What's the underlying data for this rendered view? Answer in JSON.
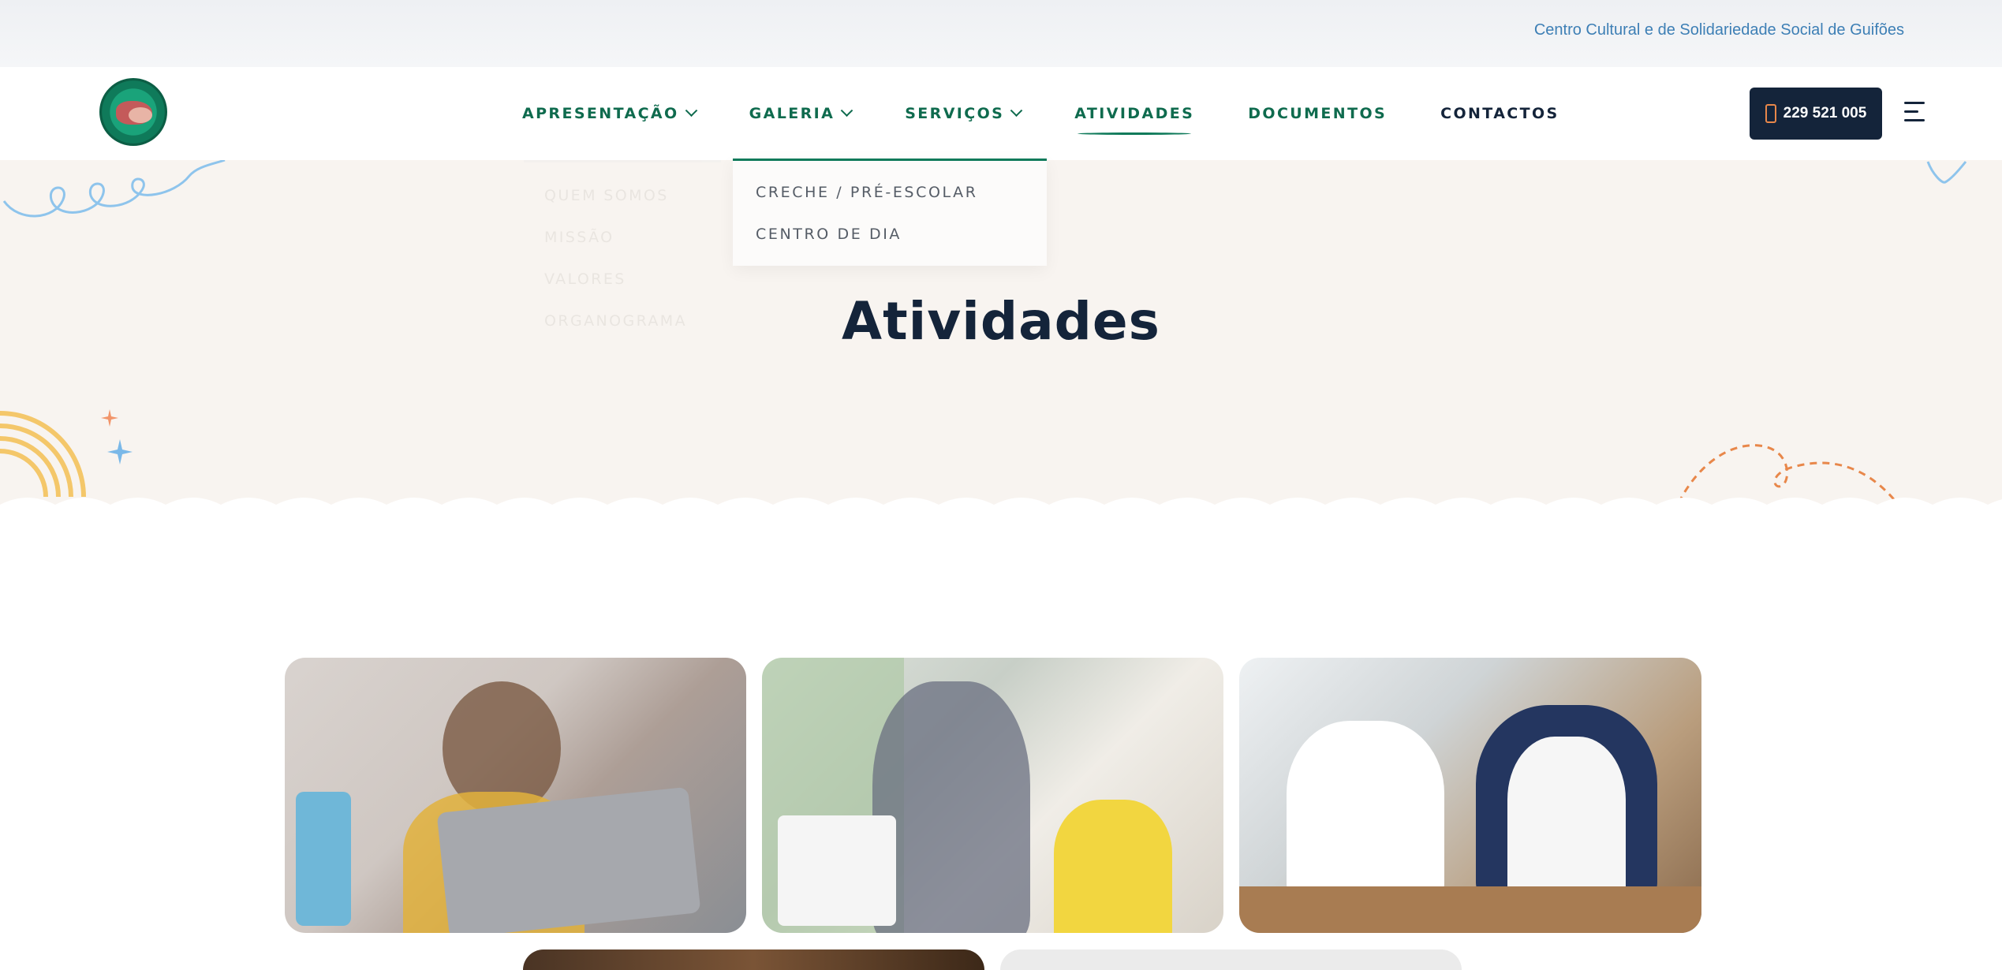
{
  "topbar": {
    "org_name": "Centro Cultural e de Solidariedade Social de Guifões"
  },
  "header": {
    "logo_alt": "logo",
    "nav": [
      {
        "label": "APRESENTAÇÃO",
        "has_dropdown": true
      },
      {
        "label": "GALERIA",
        "has_dropdown": true
      },
      {
        "label": "SERVIÇOS",
        "has_dropdown": true
      },
      {
        "label": "ATIVIDADES",
        "has_dropdown": false,
        "active": true
      },
      {
        "label": "DOCUMENTOS",
        "has_dropdown": false
      },
      {
        "label": "CONTACTOS",
        "has_dropdown": false
      }
    ],
    "phone": "229 521 005",
    "menu_icon": "hamburger-icon"
  },
  "dropdown_faded": {
    "items": [
      "QUEM SOMOS",
      "MISSÃO",
      "VALORES",
      "ORGANOGRAMA"
    ]
  },
  "dropdown_services": {
    "items": [
      "CRECHE / PRÉ-ESCOLAR",
      "CENTRO DE DIA"
    ]
  },
  "hero": {
    "title": "Atividades"
  },
  "colors": {
    "brand_green": "#0f6b4e",
    "dark_navy": "#14243a",
    "hero_bg": "#f8f4f0",
    "accent_orange": "#e8874a",
    "accent_blue": "#7ab8e8",
    "accent_yellow": "#f4c76a"
  },
  "gallery": {
    "images": [
      "child-laptop-photo",
      "teacher-student-photo",
      "kids-robotics-photo",
      "gallery-photo-4",
      "gallery-photo-5"
    ]
  }
}
